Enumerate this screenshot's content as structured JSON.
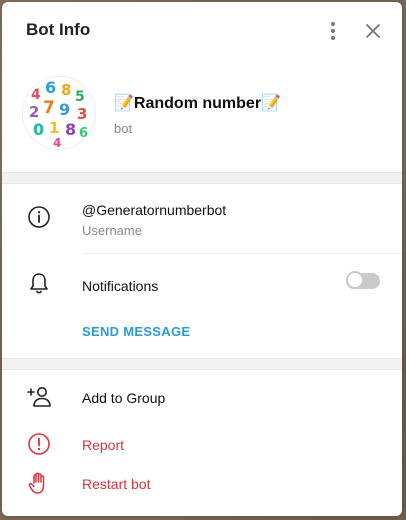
{
  "header": {
    "title": "Bot Info",
    "more_icon": "more-vertical-icon",
    "close_icon": "close-icon"
  },
  "profile": {
    "name": "📝Random number📝",
    "subtitle": "bot"
  },
  "info": {
    "username": "@Generatornumberbot",
    "username_caption": "Username",
    "notifications_label": "Notifications",
    "notifications_enabled": false,
    "send_message_label": "SEND MESSAGE"
  },
  "actions": [
    {
      "label": "Add to Group",
      "icon": "add-user-icon"
    },
    {
      "label": "Report",
      "icon": "report-icon"
    },
    {
      "label": "Restart bot",
      "icon": "hand-stop-icon"
    }
  ],
  "colors": {
    "accent": "#2a9bd6",
    "danger": "#d9353b",
    "muted": "#8a8a8a"
  }
}
